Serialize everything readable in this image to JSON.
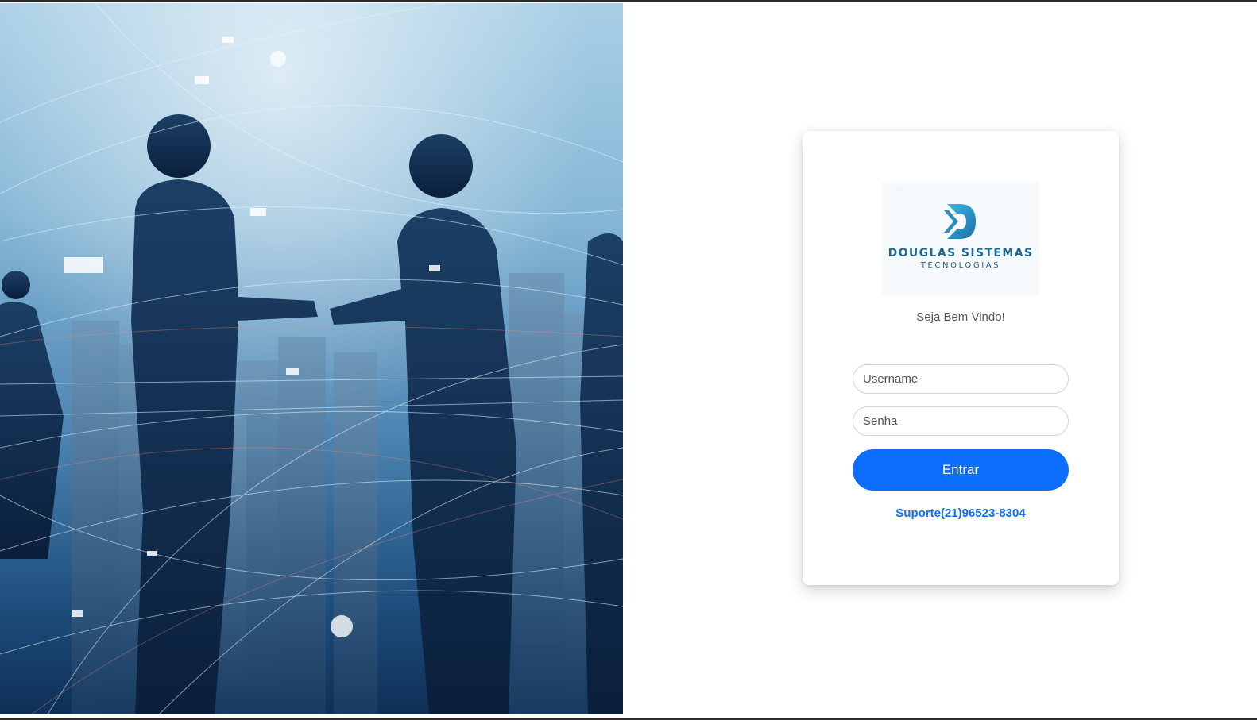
{
  "brand": {
    "name": "DOUGLAS SISTEMAS",
    "subtitle": "TECNOLOGIAS",
    "colors": {
      "primary": "#0d6efd",
      "logo_text": "#1b6a9a",
      "logo_mark_start": "#39b8e6",
      "logo_mark_end": "#1d6fa8"
    }
  },
  "hero": {
    "icon": "business-handshake-image"
  },
  "login": {
    "welcome_text": "Seja Bem Vindo!",
    "username": {
      "placeholder": "Username",
      "value": ""
    },
    "password": {
      "placeholder": "Senha",
      "value": ""
    },
    "submit_label": "Entrar",
    "support_label": "Suporte(21)96523-8304"
  }
}
